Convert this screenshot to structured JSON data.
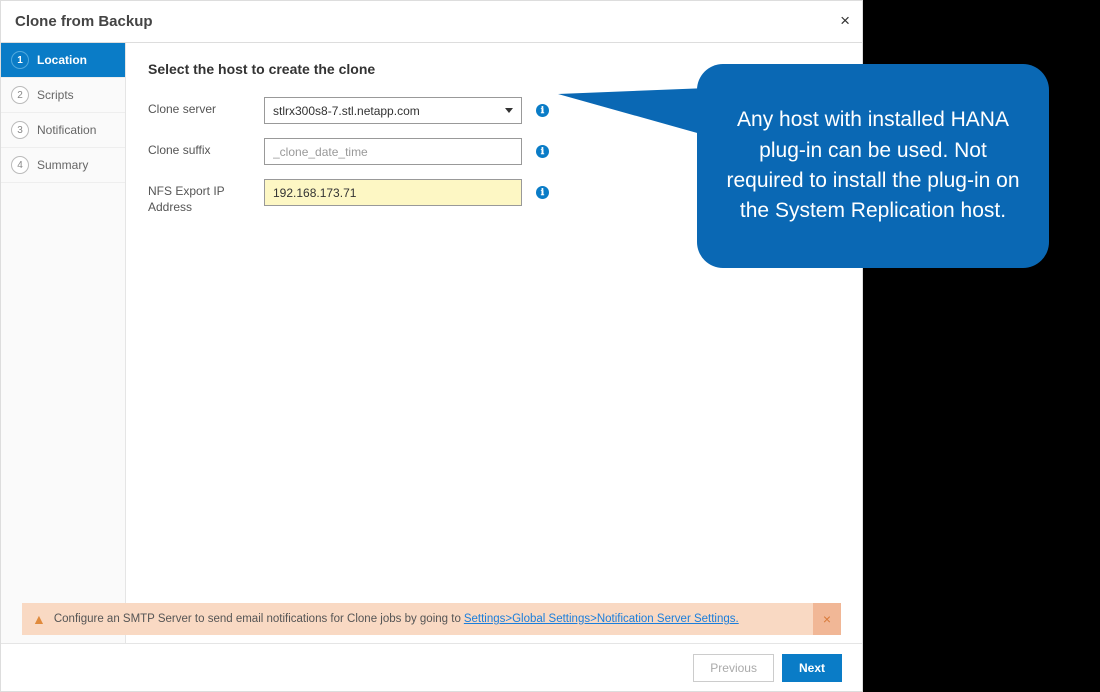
{
  "dialog": {
    "title": "Clone from Backup"
  },
  "sidebar": {
    "steps": [
      {
        "num": "1",
        "label": "Location"
      },
      {
        "num": "2",
        "label": "Scripts"
      },
      {
        "num": "3",
        "label": "Notification"
      },
      {
        "num": "4",
        "label": "Summary"
      }
    ]
  },
  "main": {
    "heading": "Select the host to create the clone",
    "clone_server_label": "Clone server",
    "clone_server_value": "stlrx300s8-7.stl.netapp.com",
    "clone_suffix_label": "Clone suffix",
    "clone_suffix_placeholder": "_clone_date_time",
    "nfs_label": "NFS Export IP Address",
    "nfs_value": "192.168.173.71"
  },
  "notif": {
    "text": "Configure an SMTP Server to send email notifications for Clone jobs by going to",
    "link": "Settings>Global Settings>Notification Server Settings."
  },
  "footer": {
    "previous": "Previous",
    "next": "Next"
  },
  "callout": {
    "text": "Any host with installed HANA plug-in can be used. Not required to install the plug-in on the System Replication host."
  }
}
